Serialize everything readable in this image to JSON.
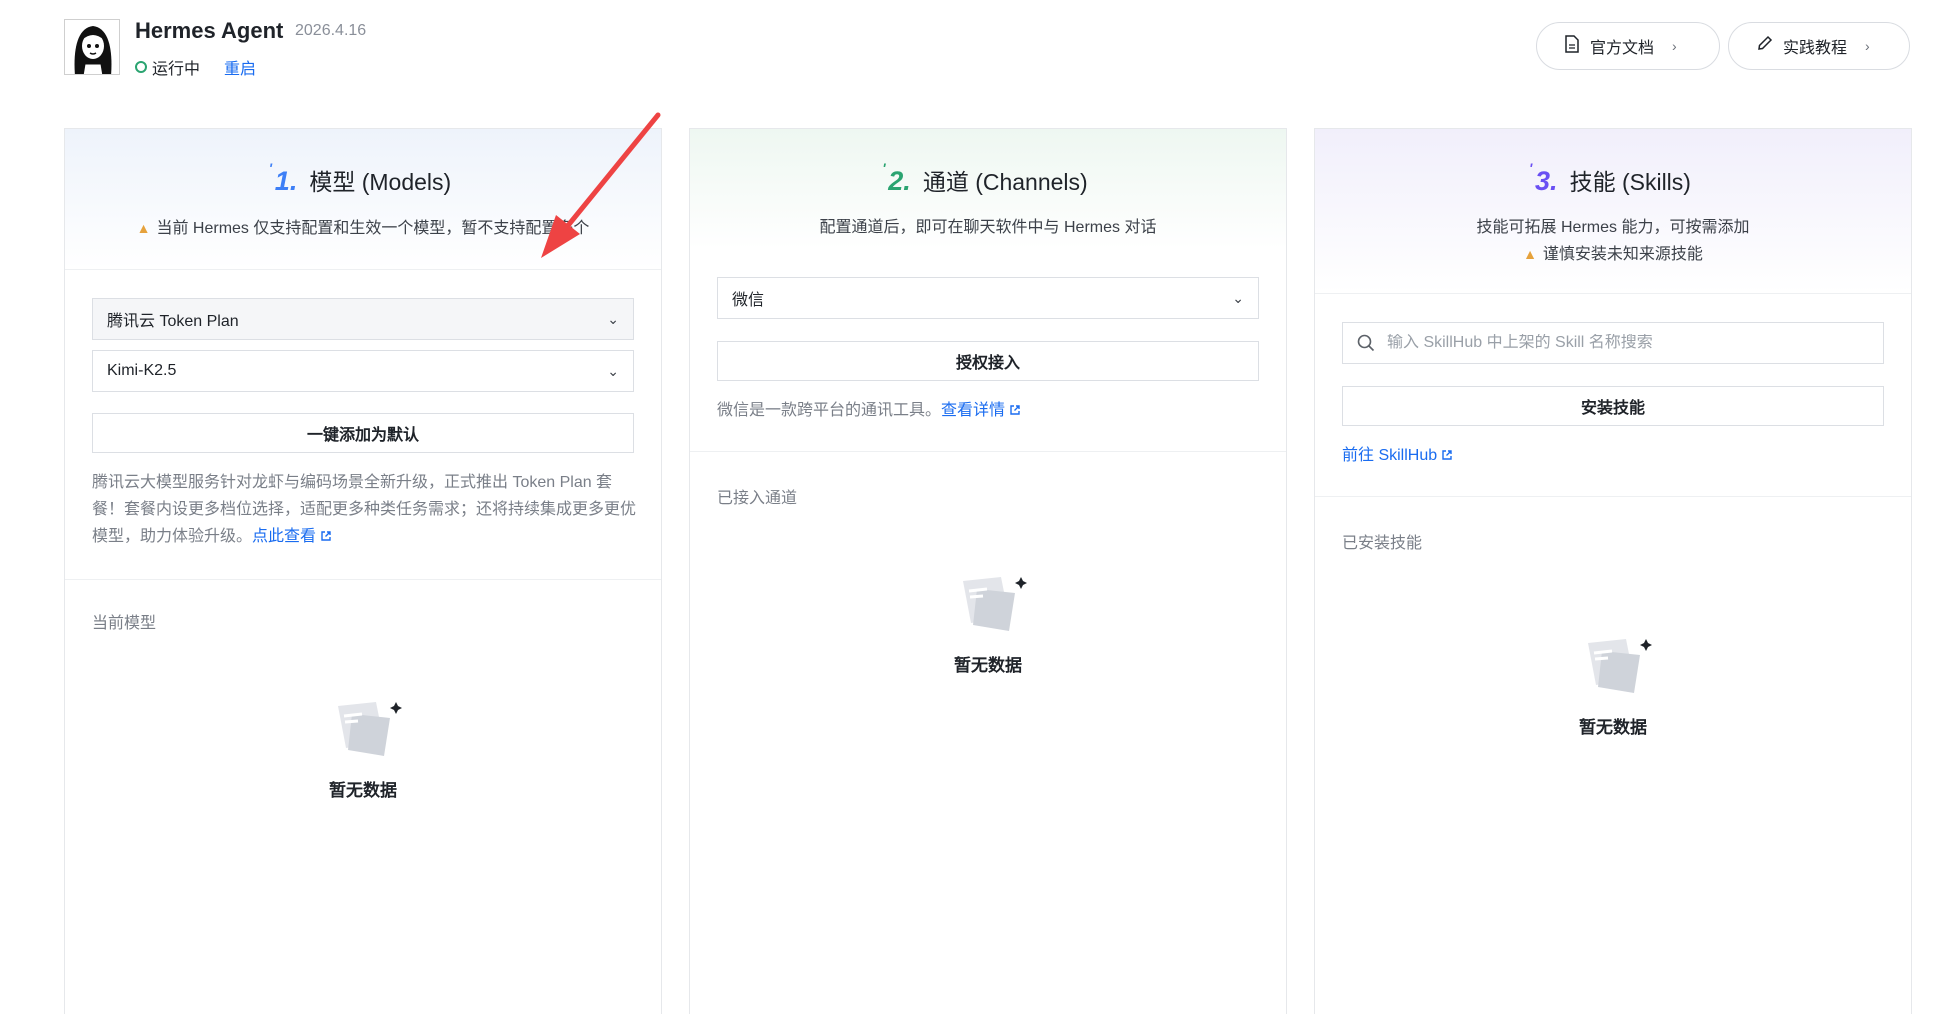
{
  "header": {
    "app_name": "Hermes Agent",
    "version": "2026.4.16",
    "status": "运行中",
    "status_color": "#2ba471",
    "restart_label": "重启",
    "docs_label": "官方文档",
    "tutorial_label": "实践教程"
  },
  "models": {
    "step": "1.",
    "title": "模型 (Models)",
    "warning": "当前 Hermes 仅支持配置和生效一个模型，暂不支持配置多个",
    "provider_select": "腾讯云 Token Plan",
    "model_select": "Kimi-K2.5",
    "add_default_button": "一键添加为默认",
    "info": "腾讯云大模型服务针对龙虾与编码场景全新升级，正式推出 Token Plan 套餐！套餐内设更多档位选择，适配更多种类任务需求；还将持续集成更多更优模型，助力体验升级。",
    "info_link": "点此查看",
    "current_label": "当前模型",
    "empty_text": "暂无数据"
  },
  "channels": {
    "step": "2.",
    "title": "通道 (Channels)",
    "description": "配置通道后，即可在聊天软件中与 Hermes 对话",
    "channel_select": "微信",
    "authorize_button": "授权接入",
    "info": "微信是一款跨平台的通讯工具。",
    "info_link": "查看详情",
    "connected_label": "已接入通道",
    "empty_text": "暂无数据"
  },
  "skills": {
    "step": "3.",
    "title": "技能 (Skills)",
    "description": "技能可拓展 Hermes 能力，可按需添加",
    "warning": "谨慎安装未知来源技能",
    "search_placeholder": "输入 SkillHub 中上架的 Skill 名称搜索",
    "install_button": "安装技能",
    "skillhub_link": "前往 SkillHub",
    "installed_label": "已安装技能",
    "empty_text": "暂无数据"
  },
  "icons": {
    "docs": "document-icon",
    "tutorial": "pencil-icon",
    "chevron": "chevron-right-icon",
    "select": "chevron-down-icon",
    "search": "search-icon",
    "external": "external-link-icon",
    "empty": "empty-box-icon",
    "warning": "warning-icon",
    "annotation": "red-arrow-annotation"
  }
}
